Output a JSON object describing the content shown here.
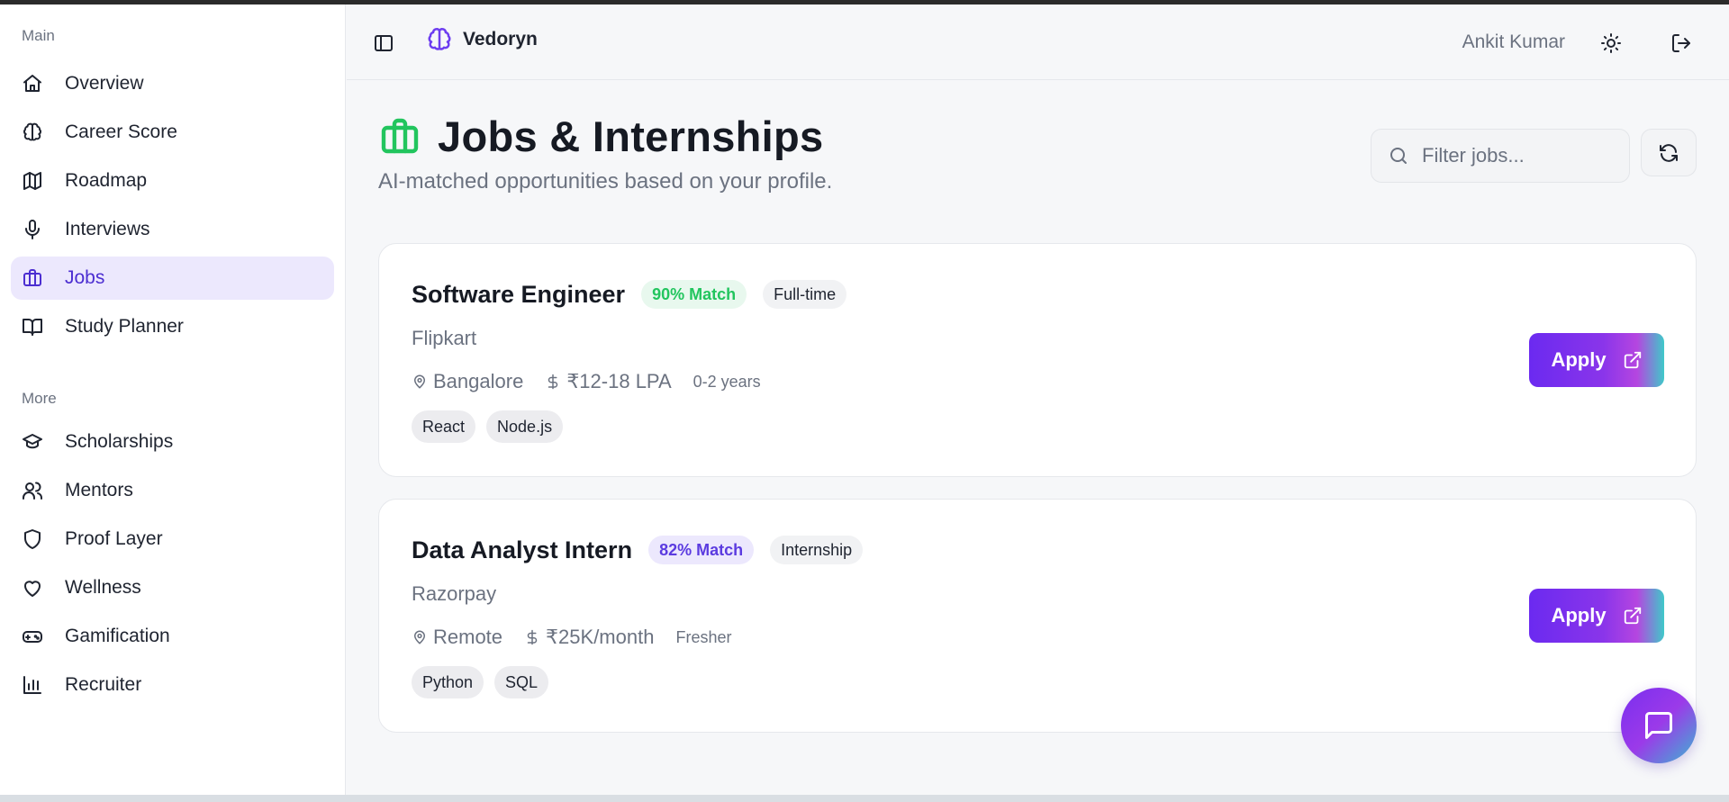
{
  "sidebar": {
    "section_main": "Main",
    "section_more": "More",
    "main_items": [
      {
        "label": "Overview",
        "icon": "home-icon"
      },
      {
        "label": "Career Score",
        "icon": "brain-icon"
      },
      {
        "label": "Roadmap",
        "icon": "map-icon"
      },
      {
        "label": "Interviews",
        "icon": "microphone-icon"
      },
      {
        "label": "Jobs",
        "icon": "briefcase-icon",
        "active": true
      },
      {
        "label": "Study Planner",
        "icon": "book-open-icon"
      }
    ],
    "more_items": [
      {
        "label": "Scholarships",
        "icon": "graduation-cap-icon"
      },
      {
        "label": "Mentors",
        "icon": "users-icon"
      },
      {
        "label": "Proof Layer",
        "icon": "shield-icon"
      },
      {
        "label": "Wellness",
        "icon": "heart-icon"
      },
      {
        "label": "Gamification",
        "icon": "gamepad-icon"
      },
      {
        "label": "Recruiter",
        "icon": "bar-chart-icon"
      }
    ]
  },
  "header": {
    "brand_name": "Vedoryn",
    "user_name": "Ankit Kumar"
  },
  "page": {
    "title": "Jobs & Internships",
    "subtitle": "AI-matched opportunities based on your profile."
  },
  "search": {
    "placeholder": "Filter jobs..."
  },
  "jobs": [
    {
      "title": "Software Engineer",
      "match": "90% Match",
      "type": "Full-time",
      "company": "Flipkart",
      "location": "Bangalore",
      "salary": "₹12-18 LPA",
      "experience": "0-2 years",
      "skills": [
        "React",
        "Node.js"
      ],
      "apply_label": "Apply"
    },
    {
      "title": "Data Analyst Intern",
      "match": "82% Match",
      "type": "Internship",
      "company": "Razorpay",
      "location": "Remote",
      "salary": "₹25K/month",
      "experience": "Fresher",
      "skills": [
        "Python",
        "SQL"
      ],
      "apply_label": "Apply"
    }
  ],
  "colors": {
    "accent": "#4c2ed1",
    "active_bg": "#ece8fd",
    "match_high_text": "#22c55e",
    "match_high_bg": "#e8f8ee",
    "match_mid_text": "#5b3be0",
    "match_mid_bg": "#ece8fd",
    "briefcase_icon": "#22c55e"
  }
}
